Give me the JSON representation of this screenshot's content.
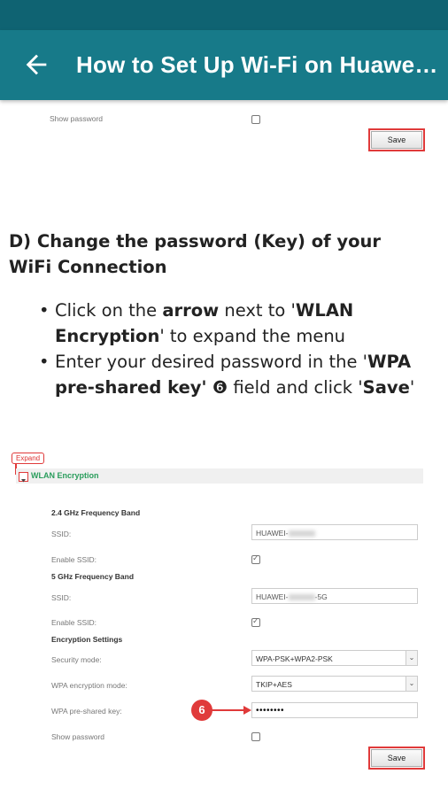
{
  "app": {
    "title": "How to Set Up Wi-Fi on Huawe…",
    "back_icon": "arrow-left-icon"
  },
  "top_section": {
    "show_password_label": "Show password",
    "save_label": "Save"
  },
  "section_d": {
    "heading": "D) Change the password (Key) of your WiFi Connection",
    "bullet1": {
      "pre": "Click on the ",
      "b1": "arrow",
      "mid": " next to '",
      "b2": "WLAN Encryption",
      "post": "' to expand the menu"
    },
    "bullet2": {
      "pre": "Enter your desired password in the '",
      "b1": "WPA pre-shared key'",
      "circle": "❻",
      "mid": " field and click '",
      "b2": "Save",
      "post": "'"
    }
  },
  "screenshot": {
    "expand_label": "Expand",
    "wlan_title": "WLAN Encryption",
    "band24_title": "2.4 GHz Frequency Band",
    "ssid_label1": "SSID:",
    "ssid_value1": "HUAWEI-",
    "enable_ssid_label1": "Enable SSID:",
    "band5_title": "5 GHz Frequency Band",
    "ssid_label2": "SSID:",
    "ssid_value2_pre": "HUAWEI-",
    "ssid_value2_post": "-5G",
    "enable_ssid_label2": "Enable SSID:",
    "encryption_settings": "Encryption Settings",
    "security_mode_label": "Security mode:",
    "security_mode_value": "WPA-PSK+WPA2-PSK",
    "wpa_mode_label": "WPA encryption mode:",
    "wpa_mode_value": "TKIP+AES",
    "psk_label": "WPA pre-shared key:",
    "psk_value": "••••••••",
    "show_password_label": "Show password",
    "save_label": "Save",
    "marker": "6"
  },
  "colors": {
    "appbar": "#177a89",
    "statusbar": "#0f6372",
    "highlight": "#e03a3a",
    "wlan_green": "#2a9d5c"
  }
}
